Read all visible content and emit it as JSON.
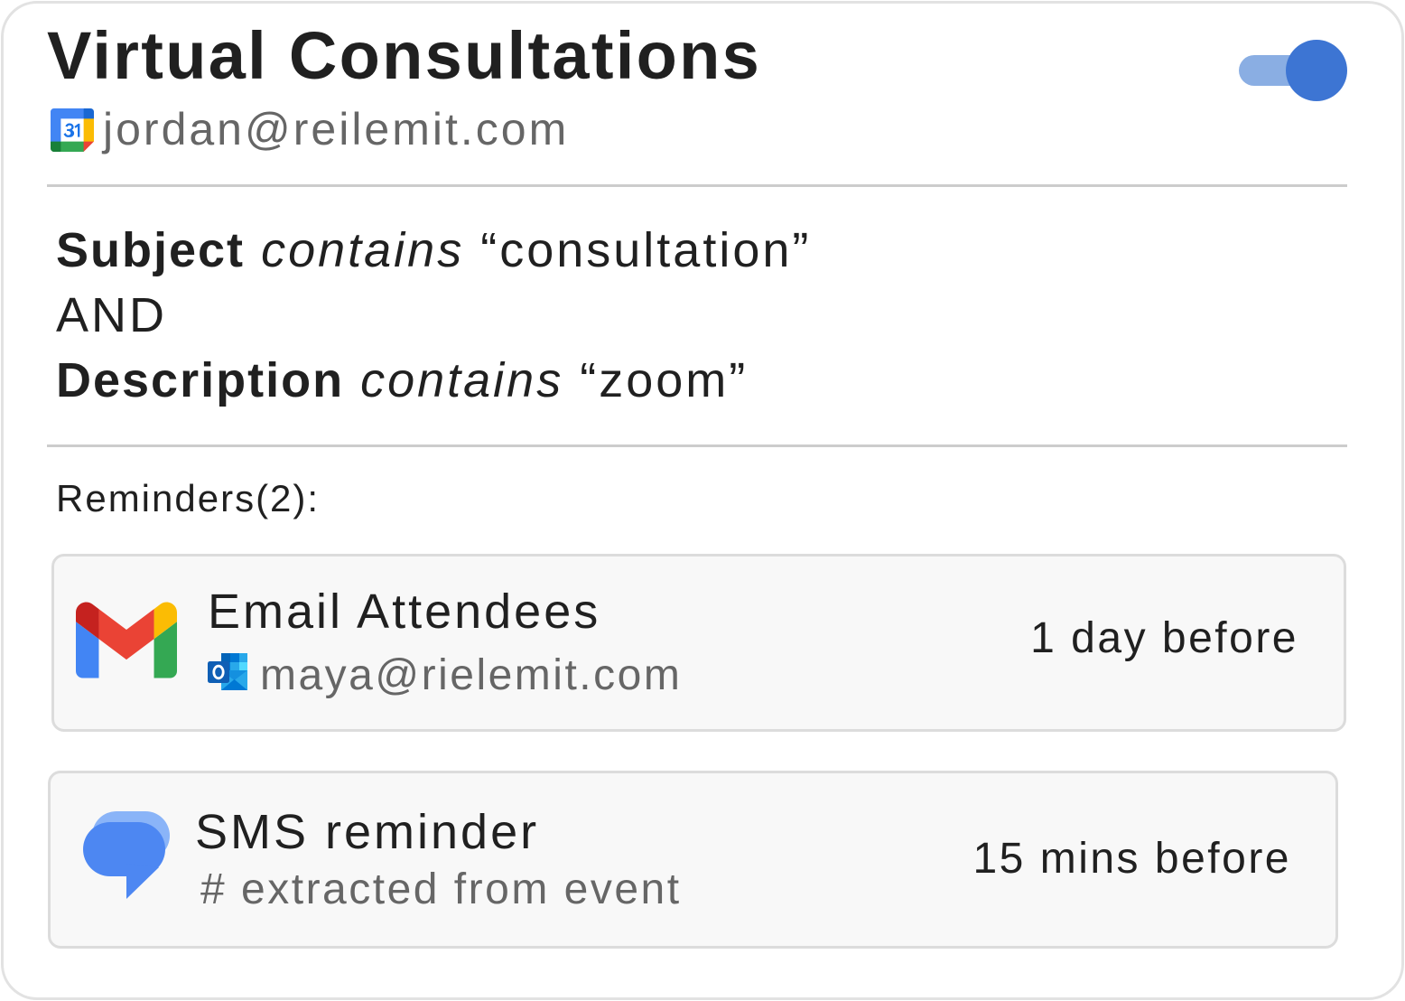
{
  "rule": {
    "title": "Virtual Consultations",
    "enabled": true,
    "calendar": {
      "icon": "google-calendar-icon",
      "account": "jordan@reilemit.com"
    },
    "conditions": {
      "items": [
        {
          "field": "Subject",
          "operator": "contains",
          "value": "“consultation”"
        },
        {
          "field": "Description",
          "operator": "contains",
          "value": "“zoom”"
        }
      ],
      "joiner": "AND"
    }
  },
  "reminders": {
    "heading": "Reminders(2):",
    "items": [
      {
        "icon": "gmail-icon",
        "title": "Email Attendees",
        "account_icon": "outlook-icon",
        "account": "maya@rielemit.com",
        "timing": "1 day before"
      },
      {
        "icon": "google-messages-icon",
        "title": "SMS reminder",
        "recipient": "# extracted from event",
        "timing": "15 mins before"
      }
    ]
  },
  "colors": {
    "text": "#202020",
    "muted_text": "#666666",
    "divider": "#cccccc",
    "toggle_track": "#8aaee3",
    "toggle_knob": "#3d75d3",
    "reminder_bg": "#f8f8f8",
    "reminder_border": "#dcdcdc"
  }
}
